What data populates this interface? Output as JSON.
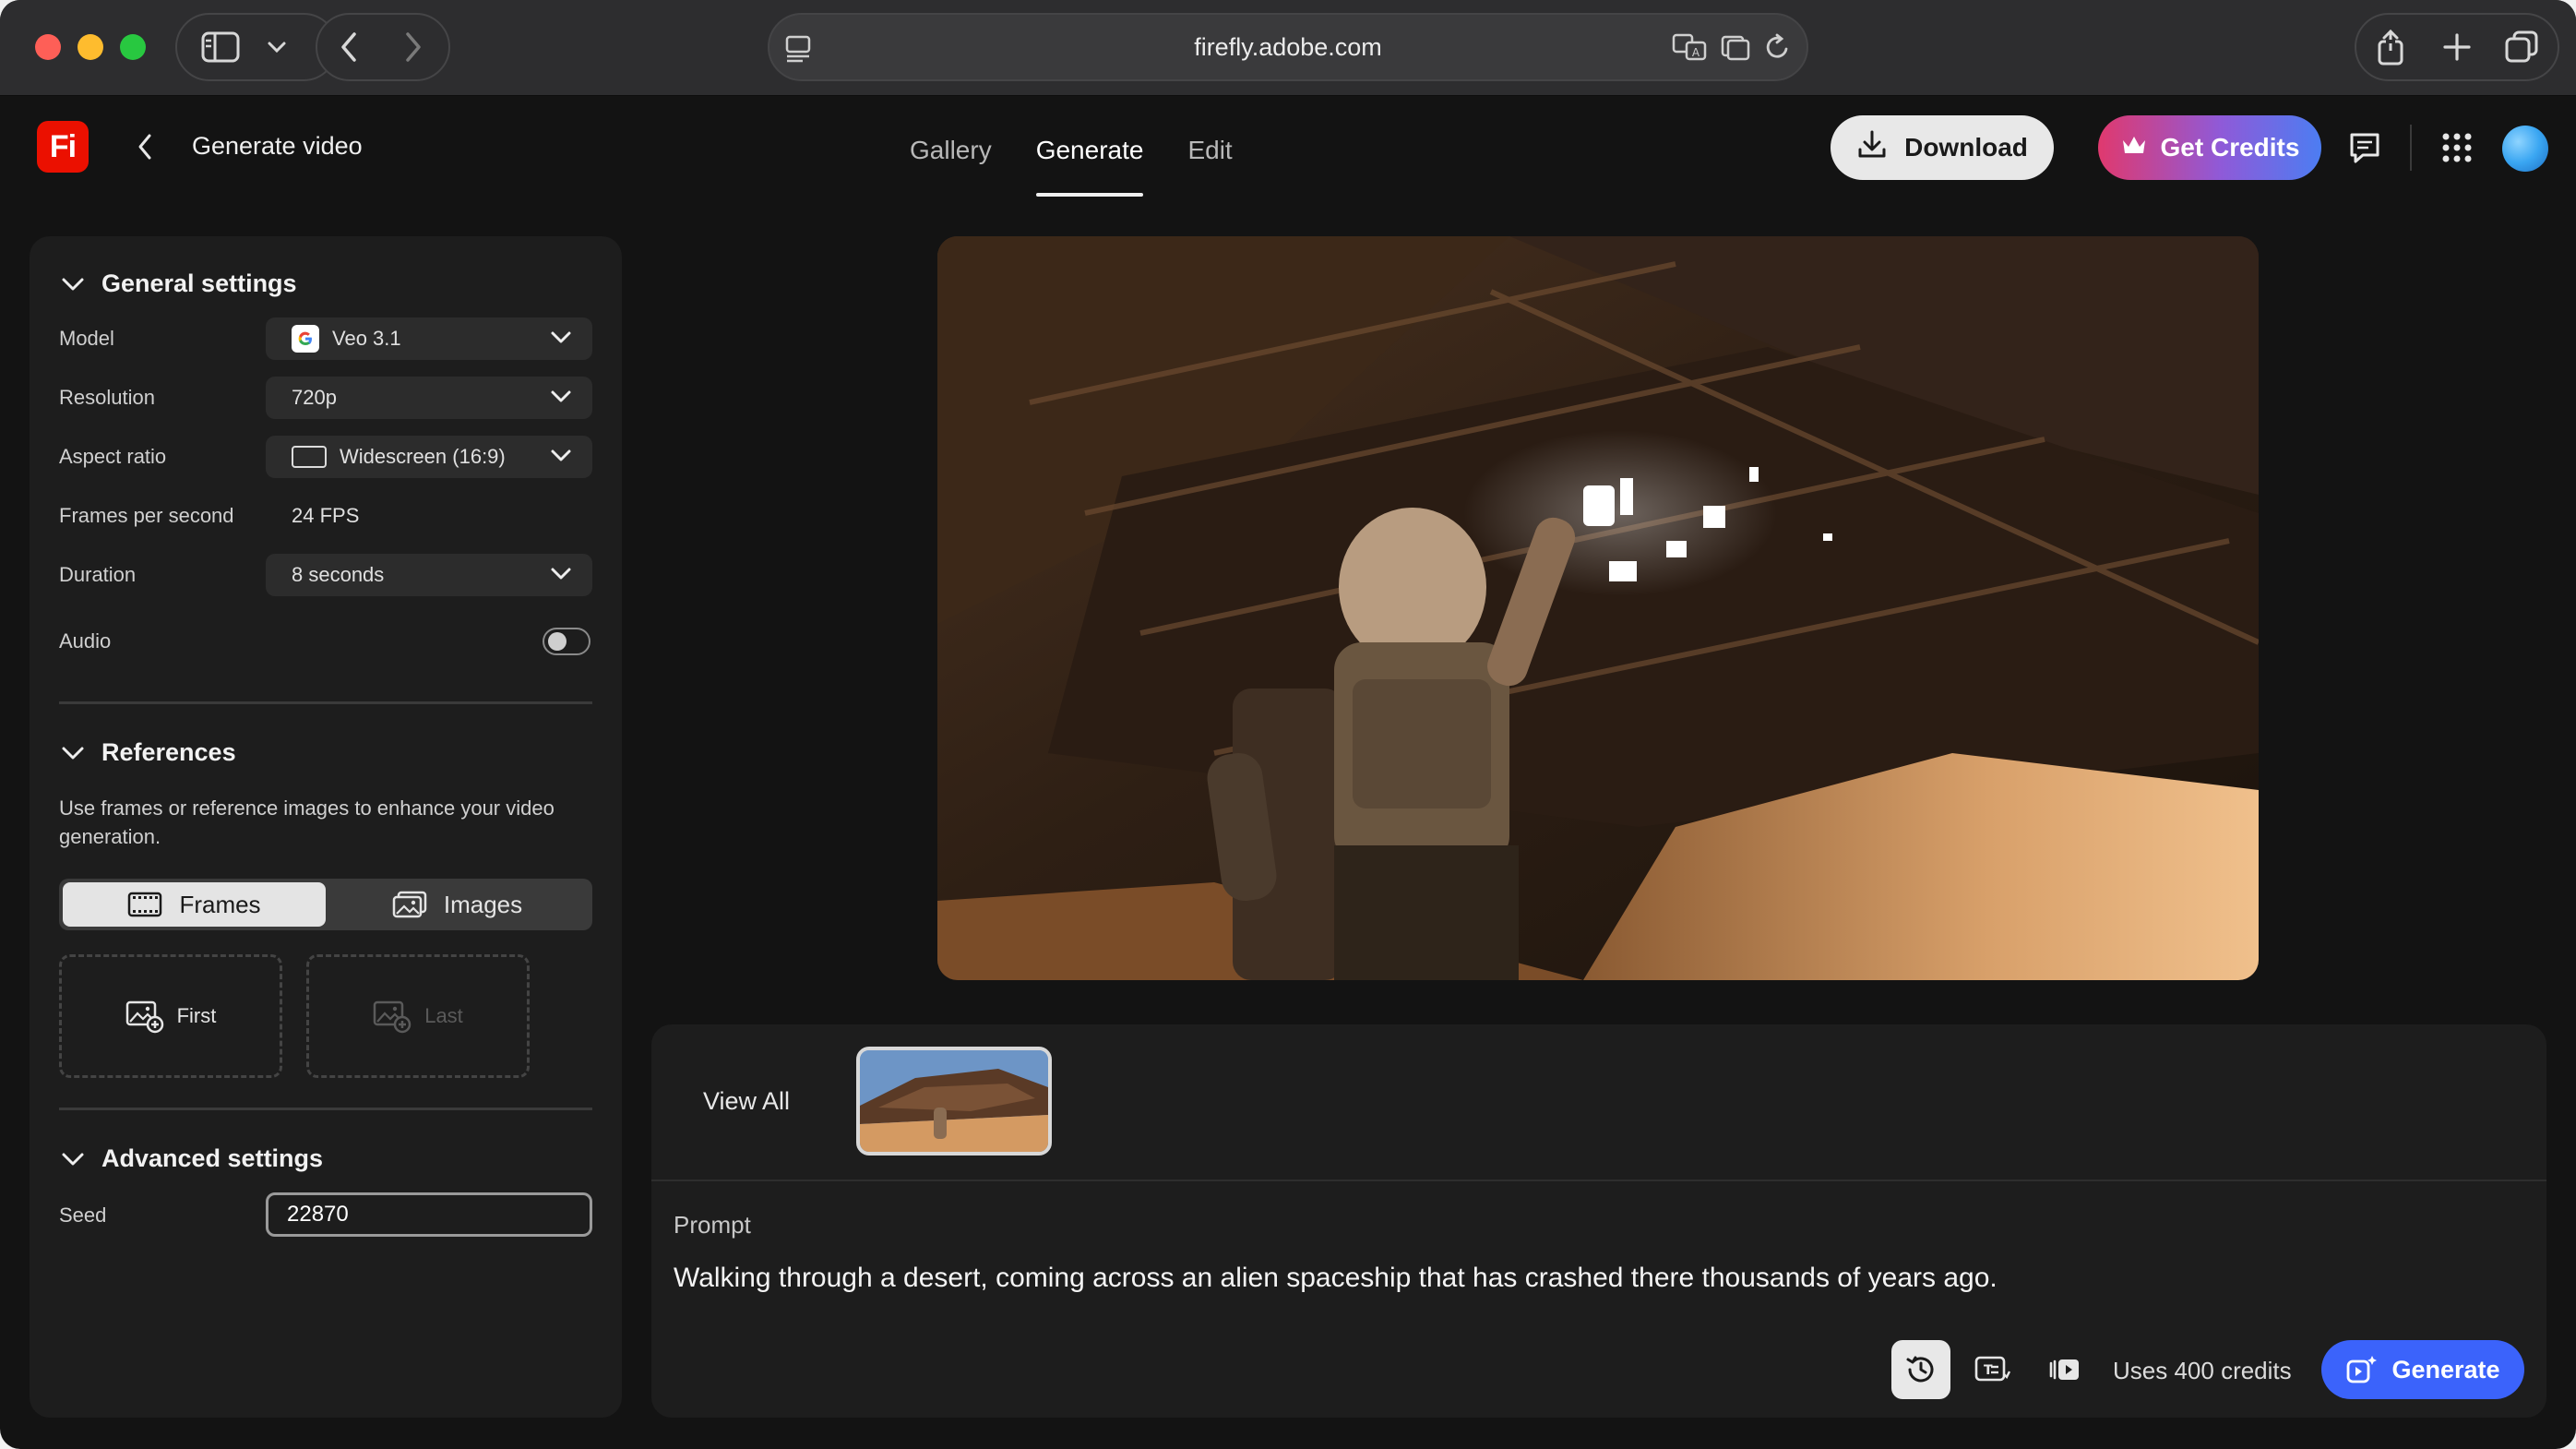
{
  "browser": {
    "url": "firefly.adobe.com"
  },
  "app": {
    "logo_text": "Fi",
    "page_title": "Generate video",
    "tabs": [
      {
        "label": "Gallery",
        "active": false
      },
      {
        "label": "Generate",
        "active": true
      },
      {
        "label": "Edit",
        "active": false
      }
    ],
    "download_label": "Download",
    "credits_label": "Get Credits"
  },
  "sidebar": {
    "general": {
      "title": "General settings",
      "model_label": "Model",
      "model_value": "Veo 3.1",
      "resolution_label": "Resolution",
      "resolution_value": "720p",
      "aspect_label": "Aspect ratio",
      "aspect_value": "Widescreen (16:9)",
      "fps_label": "Frames per second",
      "fps_value": "24 FPS",
      "duration_label": "Duration",
      "duration_value": "8 seconds",
      "audio_label": "Audio",
      "audio_on": false
    },
    "references": {
      "title": "References",
      "description": "Use frames or reference images to enhance your video generation.",
      "segments": [
        {
          "label": "Frames",
          "active": true
        },
        {
          "label": "Images",
          "active": false
        }
      ],
      "first_label": "First",
      "last_label": "Last"
    },
    "advanced": {
      "title": "Advanced settings",
      "seed_label": "Seed",
      "seed_value": "22870"
    }
  },
  "bottom": {
    "view_all_label": "View All",
    "prompt_label": "Prompt",
    "prompt_text": "Walking through a desert, coming across an alien spaceship that has crashed there thousands of years ago.",
    "credits_text": "Uses 400 credits",
    "generate_label": "Generate"
  },
  "colors": {
    "accent_blue": "#3b63fb",
    "firefly_red": "#eb1000"
  }
}
